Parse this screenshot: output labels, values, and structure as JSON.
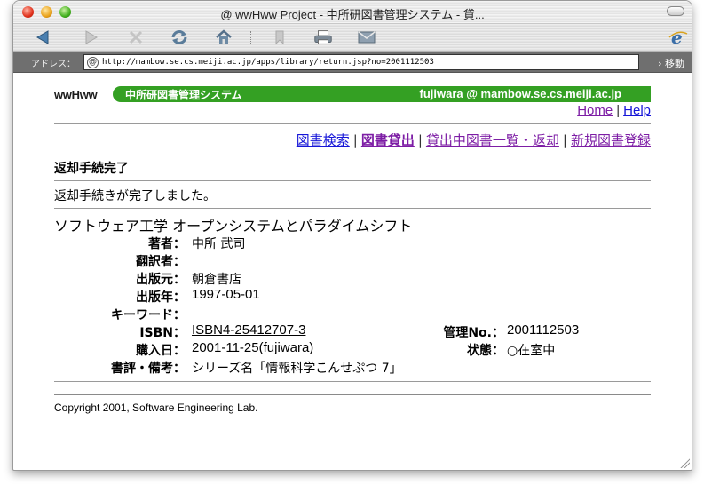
{
  "window": {
    "title": "@ wwHww Project - 中所研図書管理システム - 貸..."
  },
  "toolbar": {
    "buttons": [
      "back-icon",
      "forward-icon",
      "stop-icon",
      "refresh-icon",
      "home-icon",
      "favorites-icon",
      "print-icon",
      "mail-icon",
      "ie-logo"
    ]
  },
  "address": {
    "label": "アドレス：",
    "url": "http://mambow.se.cs.meiji.ac.jp/apps/library/return.jsp?no=2001112503",
    "go_label": "› 移動"
  },
  "header": {
    "logo": "wwHww",
    "system_name": "中所研図書管理システム",
    "user": "fujiwara @ mambow.se.cs.meiji.ac.jp",
    "banner_color": "#34a023"
  },
  "toplinks": {
    "home": "Home",
    "separator": "|",
    "help": "Help"
  },
  "nav": {
    "search": "図書検索",
    "lend": "図書貸出",
    "list_return": "貸出中図書一覧・返却",
    "register": "新規図書登録",
    "separator": "|"
  },
  "page": {
    "section_title": "返却手続完了",
    "message": "返却手続きが完了しました。"
  },
  "book": {
    "title": "ソフトウェア工学 オープンシステムとパラダイムシフト",
    "author_label": "著者：",
    "author": "中所 武司",
    "translator_label": "翻訳者：",
    "translator": "",
    "publisher_label": "出版元：",
    "publisher": "朝倉書店",
    "year_label": "出版年：",
    "year": "1997-05-01",
    "keyword_label": "キーワード：",
    "keyword": "",
    "isbn_label": "ISBN：",
    "isbn": "ISBN4-25412707-3",
    "purchase_label": "購入日：",
    "purchase": "2001-11-25(fujiwara)",
    "notes_label": "書評・備考：",
    "notes": "シリーズ名「情報科学こんせぷつ 7」",
    "mgmt_label": "管理No.：",
    "mgmt_no": "2001112503",
    "status_label": "状態：",
    "status": "○在室中"
  },
  "footer": {
    "copyright": "Copyright 2001, Software Engineering Lab."
  }
}
